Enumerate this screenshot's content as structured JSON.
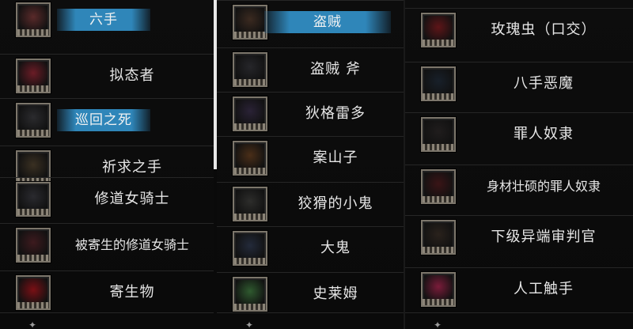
{
  "column1": [
    {
      "name": "六手",
      "highlight": true,
      "portrait": "demon-skull-icon",
      "tint": "#5a2a2a"
    },
    {
      "name": "拟态者",
      "highlight": false,
      "portrait": "mimic-chest-icon",
      "tint": "#6b1c26"
    },
    {
      "name": "巡回之死",
      "highlight": true,
      "portrait": "dark-haired-girl-icon",
      "tint": "#2b2b2e"
    },
    {
      "name": "祈求之手",
      "highlight": false,
      "portrait": "framed-painting-icon",
      "tint": "#3a3022"
    },
    {
      "name": "修道女骑士",
      "highlight": false,
      "portrait": "nun-knight-icon",
      "tint": "#2a2a2f"
    },
    {
      "name": "被寄生的修道女骑士",
      "highlight": false,
      "portrait": "parasitized-nun-icon",
      "tint": "#3d1a1e"
    },
    {
      "name": "寄生物",
      "highlight": false,
      "portrait": "parasite-blob-icon",
      "tint": "#7a1015"
    }
  ],
  "column2": [
    {
      "name": "盗贼",
      "highlight": true,
      "portrait": "thief-icon",
      "tint": "#3b2a20"
    },
    {
      "name": "盗贼 斧",
      "highlight": false,
      "portrait": "thief-axe-icon",
      "tint": "#26262a"
    },
    {
      "name": "狄格雷多",
      "highlight": false,
      "portrait": "digredo-icon",
      "tint": "#2a2236"
    },
    {
      "name": "案山子",
      "highlight": false,
      "portrait": "scarecrow-icon",
      "tint": "#4a2e18"
    },
    {
      "name": "狡猾的小鬼",
      "highlight": false,
      "portrait": "sly-imp-icon",
      "tint": "#2d2d2b"
    },
    {
      "name": "大鬼",
      "highlight": false,
      "portrait": "ogre-icon",
      "tint": "#232a3a"
    },
    {
      "name": "史莱姆",
      "highlight": false,
      "portrait": "slime-icon",
      "tint": "#2f5a2f"
    }
  ],
  "column3": [
    {
      "name": "玫瑰虫（口交）",
      "highlight": false,
      "portrait": "rose-worm-icon",
      "tint": "#5e1518"
    },
    {
      "name": "八手恶魔",
      "highlight": false,
      "portrait": "eight-hand-demon-icon",
      "tint": "#18202a"
    },
    {
      "name": "罪人奴隶",
      "highlight": false,
      "portrait": "sinner-slave-icon",
      "tint": "#201d1d"
    },
    {
      "name": "身材壮硕的罪人奴隶",
      "highlight": false,
      "portrait": "burly-sinner-slave-icon",
      "tint": "#3a1416"
    },
    {
      "name": "下级异端审判官",
      "highlight": false,
      "portrait": "plague-inquisitor-icon",
      "tint": "#2a221c"
    },
    {
      "name": "人工触手",
      "highlight": false,
      "portrait": "artificial-tentacle-icon",
      "tint": "#7a1c3a"
    }
  ]
}
